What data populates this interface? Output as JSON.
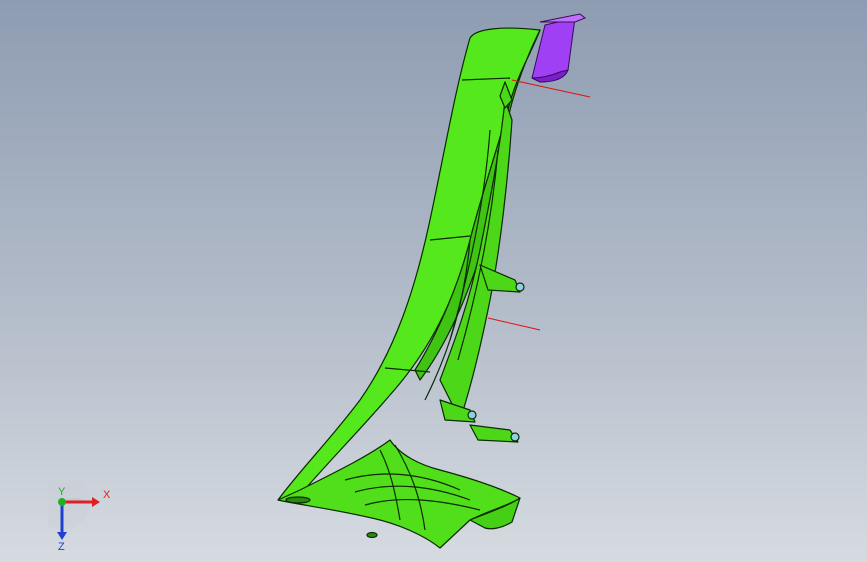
{
  "view_triad": {
    "x_label": "X",
    "y_label": "Y",
    "z_label": "Z",
    "x_color": "#e02020",
    "y_color": "#20b020",
    "z_color": "#2040d0"
  },
  "model": {
    "part_color": "#4fe31a",
    "part_edge_color": "#0a2a00",
    "tool_color": "#9b30f0",
    "reference_line_color": "#e01010"
  },
  "icons": {
    "triad": "coordinate-triad-icon"
  }
}
